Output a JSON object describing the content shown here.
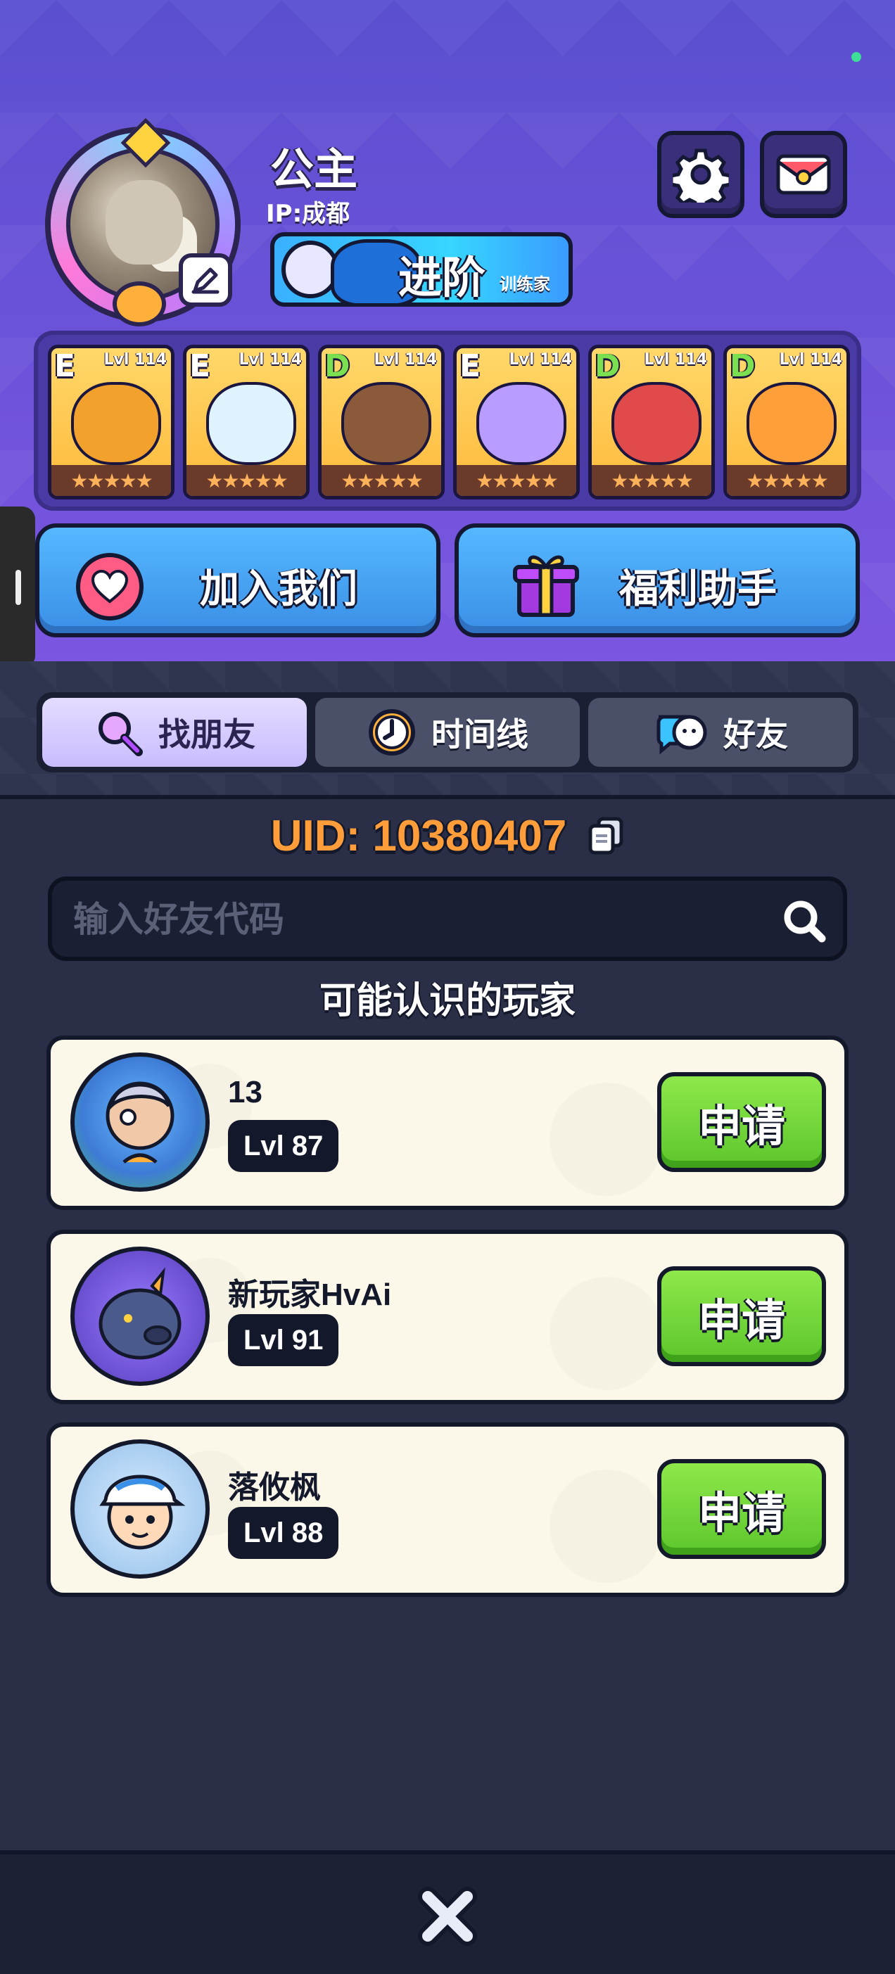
{
  "profile": {
    "name": "公主",
    "ip": "IP:成都",
    "rank_title": "进阶",
    "rank_subtitle": "训练家"
  },
  "top_icons": [
    "settings-gear-icon",
    "mail-icon"
  ],
  "team": [
    {
      "grade": "E",
      "level": "Lvl 114",
      "stars": 5,
      "color": "#f2a22c"
    },
    {
      "grade": "E",
      "level": "Lvl 114",
      "stars": 5,
      "color": "#dff3ff"
    },
    {
      "grade": "D",
      "level": "Lvl 114",
      "stars": 5,
      "color": "#8a5a3a"
    },
    {
      "grade": "E",
      "level": "Lvl 114",
      "stars": 5,
      "color": "#b89cff"
    },
    {
      "grade": "D",
      "level": "Lvl 114",
      "stars": 5,
      "color": "#e14a4a"
    },
    {
      "grade": "D",
      "level": "Lvl 114",
      "stars": 5,
      "color": "#ff9f3a"
    }
  ],
  "actions": {
    "join": "加入我们",
    "welfare": "福利助手"
  },
  "tabs": {
    "find": "找朋友",
    "timeline": "时间线",
    "friends": "好友",
    "active": "find"
  },
  "uid": "UID: 10380407",
  "search": {
    "placeholder": "输入好友代码"
  },
  "suggest_title": "可能认识的玩家",
  "players": [
    {
      "name": "13",
      "level": "Lvl 87",
      "action": "申请"
    },
    {
      "name": "新玩家HvAi",
      "level": "Lvl 91",
      "action": "申请"
    },
    {
      "name": "落攸枫",
      "level": "Lvl 88",
      "action": "申请"
    }
  ],
  "colors": {
    "accent_purple": "#6a52d8",
    "button_blue": "#3a8fe6",
    "apply_green": "#5cc62c",
    "uid_orange": "#ff9d3a"
  }
}
